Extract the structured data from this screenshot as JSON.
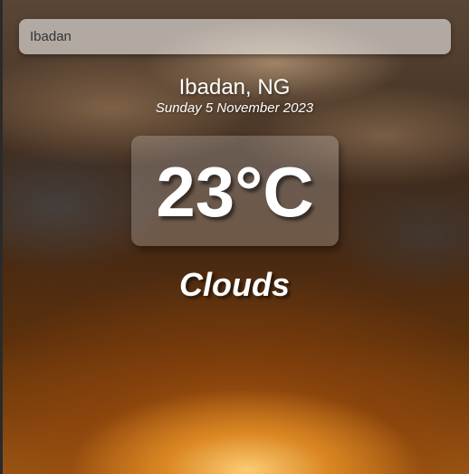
{
  "search": {
    "value": "Ibadan"
  },
  "location": {
    "name": "Ibadan, NG",
    "date": "Sunday 5 November 2023"
  },
  "weather": {
    "temperature": "23°C",
    "condition": "Clouds"
  }
}
